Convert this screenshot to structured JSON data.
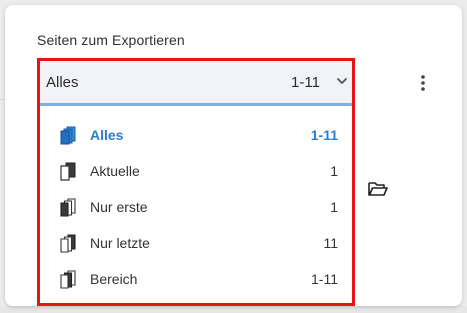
{
  "dialog": {
    "title": "Seiten zum Exportieren"
  },
  "select": {
    "value": "Alles",
    "range": "1-11"
  },
  "options": [
    {
      "label": "Alles",
      "count": "1-11",
      "icon": "all-pages-icon",
      "selected": true
    },
    {
      "label": "Aktuelle",
      "count": "1",
      "icon": "current-page-icon",
      "selected": false
    },
    {
      "label": "Nur erste",
      "count": "1",
      "icon": "first-page-icon",
      "selected": false
    },
    {
      "label": "Nur letzte",
      "count": "11",
      "icon": "last-page-icon",
      "selected": false
    },
    {
      "label": "Bereich",
      "count": "1-11",
      "icon": "range-pages-icon",
      "selected": false
    }
  ],
  "colors": {
    "accent": "#2a7fd0",
    "highlight_border": "#e31515",
    "select_underline": "#7fb0dc"
  },
  "icons": {
    "kebab": "more-vert-icon",
    "folder": "folder-open-icon",
    "chevron": "chevron-down-icon"
  }
}
